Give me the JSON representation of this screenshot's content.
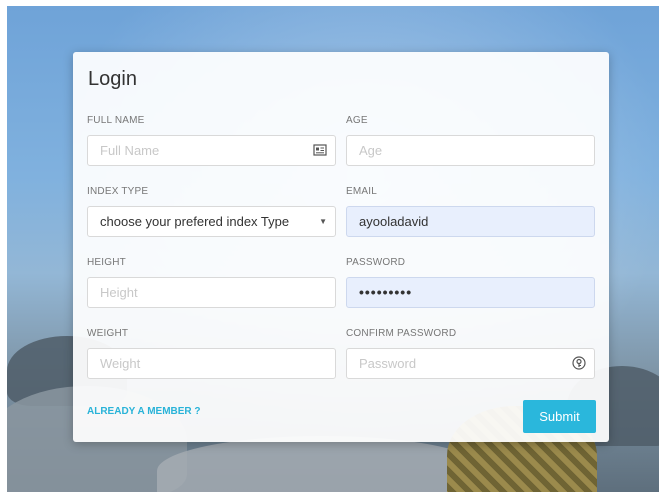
{
  "form": {
    "title": "Login",
    "fields": {
      "full_name": {
        "label": "FULL NAME",
        "placeholder": "Full Name"
      },
      "age": {
        "label": "AGE",
        "placeholder": "Age"
      },
      "index_type": {
        "label": "INDEX TYPE",
        "selected": "choose your prefered index Type"
      },
      "email": {
        "label": "EMAIL",
        "value": "ayooladavid"
      },
      "height": {
        "label": "HEIGHT",
        "placeholder": "Height"
      },
      "password": {
        "label": "PASSWORD",
        "value": "•••••••••"
      },
      "weight": {
        "label": "WEIGHT",
        "placeholder": "Weight"
      },
      "confirm_password": {
        "label": "CONFIRM PASSWORD",
        "placeholder": "Password"
      }
    },
    "already_member_link": "ALREADY A MEMBER ?",
    "submit_label": "Submit"
  },
  "icons": {
    "full_name_icon": "contact-card-icon",
    "confirm_password_icon": "key-icon",
    "select_caret": "▼"
  },
  "colors": {
    "accent": "#2ab7dc",
    "autofill_bg": "#e8effd"
  }
}
